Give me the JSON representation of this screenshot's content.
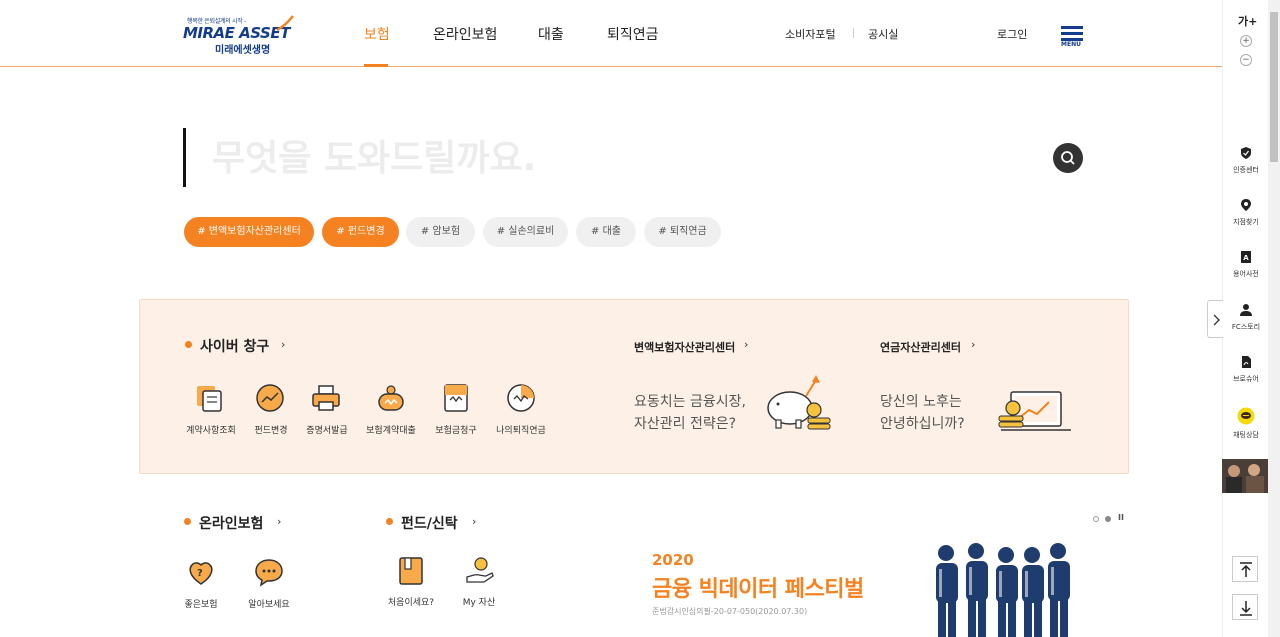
{
  "header": {
    "logo": {
      "slogan": "행복한 은퇴설계의 시작 -",
      "en": "MIRAE ASSET",
      "ko": "미래에셋생명"
    },
    "gnb": [
      "보험",
      "온라인보험",
      "대출",
      "퇴직연금"
    ],
    "util": [
      "소비자포털",
      "공시실",
      "로그인"
    ],
    "menu_label": "MENU"
  },
  "search": {
    "placeholder": "무엇을 도와드릴까요."
  },
  "tags": [
    "# 변액보험자산관리센터",
    "# 펀드변경",
    "# 암보험",
    "# 실손의료비",
    "# 대출",
    "# 퇴직연금"
  ],
  "cyber": {
    "title": "사이버 창구",
    "items": [
      "계약사항조회",
      "펀드변경",
      "증명서발급",
      "보험계약대출",
      "보험금청구",
      "나의퇴직연금"
    ]
  },
  "variable_center": {
    "title": "변액보험자산관리센터",
    "desc_line1": "요동치는 금융시장,",
    "desc_line2": "자산관리 전략은?"
  },
  "pension_center": {
    "title": "연금자산관리센터",
    "desc_line1": "당신의 노후는",
    "desc_line2": "안녕하십니까?"
  },
  "online": {
    "title": "온라인보험",
    "items": [
      "좋은보험",
      "알아보세요"
    ]
  },
  "fund": {
    "title": "펀드/신탁",
    "items": [
      "처음이세요?",
      "My 자산"
    ]
  },
  "banner": {
    "year": "2020",
    "title": "금융 빅데이터 페스티벌",
    "note": "준법감시인심의필-20-07-050(2020.07.30)",
    "pause_label": "II"
  },
  "quickbar": {
    "font_label": "가+",
    "plus": "+",
    "minus": "−",
    "items": [
      "인증센터",
      "지점찾기",
      "용어사전",
      "FC스토리",
      "브로슈어",
      "채팅상담"
    ]
  },
  "colors": {
    "accent": "#f58220",
    "navy": "#143c8c",
    "panel_bg": "#fdf1e7"
  }
}
